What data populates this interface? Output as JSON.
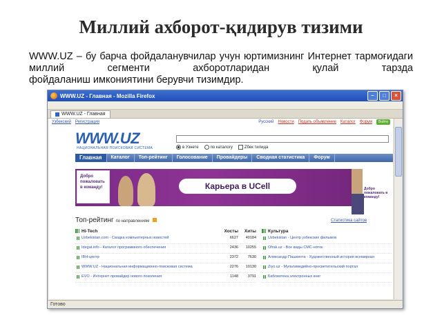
{
  "slide": {
    "title": "Миллий ахборот-қидирув тизими",
    "text_lines": [
      "WWW.UZ – бу барча фойдаланувчилар учун юртимизнинг Интернет",
      "тармоғидаги миллий сегменти ахборотларидан қулай тарзда",
      "фойдаланиш имкониятини берувчи тизимдир."
    ]
  },
  "browser": {
    "window_title": "WWW.UZ - Главная - Mozilla Firefox",
    "tab_label": "WWW.UZ - Главная",
    "status": "Готово",
    "buttons": {
      "minimize": "–",
      "maximize": "□",
      "close": "×"
    }
  },
  "site": {
    "topnav": [
      "Узбекский",
      "Регистрация",
      "Русский",
      "Новости",
      "Подать объявление",
      "Каталог",
      "Форум"
    ],
    "topnav_button": "Войти",
    "logo": "WWW.UZ",
    "logo_sub": "НАЦИОНАЛЬНАЯ ПОИСКОВАЯ СИСТЕМА",
    "search": {
      "placeholder": "",
      "option1": "в Узнете",
      "option2": "по каталогу",
      "option3": "Zбек тилида"
    },
    "menu": [
      "Главная",
      "Каталог",
      "Топ-рейтинг",
      "Голосование",
      "Провайдеры",
      "Сводная статистика",
      "Форум"
    ],
    "banner": {
      "promo": "Добро пожаловать в команду!",
      "career": "Карьера в UCell",
      "promo2": "Добро пожаловать в команду!"
    },
    "rating": {
      "title": "Топ-рейтинг",
      "subtitle": "по направлениям",
      "right_link": "Статистика сайтов"
    },
    "hitech": {
      "title": "Hi-Tech",
      "col1": "Хосты",
      "col2": "Хиты",
      "rows": [
        {
          "name": "Uzbekistan.com - Сводка компьютерных новостей",
          "hosts": "6627",
          "hits": "40184"
        },
        {
          "name": "Idegat.info - Каталог программного обеспечения",
          "hosts": "2436",
          "hits": "10255"
        },
        {
          "name": "IBH-центр",
          "hosts": "2372",
          "hits": "7630"
        },
        {
          "name": "WWW.UZ - Национальная информационно-поисковая система",
          "hosts": "2276",
          "hits": "10130"
        },
        {
          "name": "EVO - Интернет провайдер нового поколения",
          "hosts": "1148",
          "hits": "3791"
        }
      ]
    },
    "culture": {
      "title": "Культура",
      "rows": [
        {
          "name": "Uzbekistan - Центр узбекских фильмов"
        },
        {
          "name": "Ofrak.uz - Все виды СМС-ноток"
        },
        {
          "name": "Аликсандр Пашкента - Художественный история всемирная"
        },
        {
          "name": "Ziyo.uz - Мультимедийно-просветительский портал"
        },
        {
          "name": "Библиотека электронных книг"
        }
      ]
    }
  }
}
